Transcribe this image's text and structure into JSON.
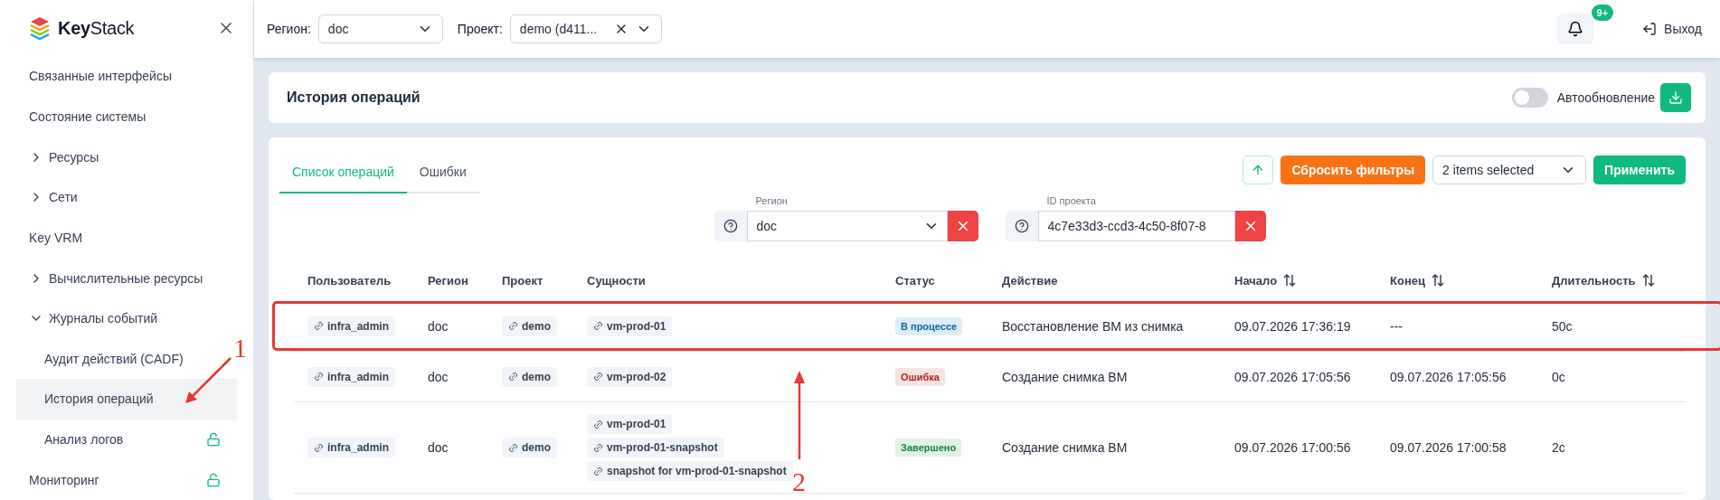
{
  "sidebar": {
    "logo": "**Key**Stack",
    "items": [
      {
        "label": "Связанные интерфейсы",
        "selected": false,
        "locked": false
      },
      {
        "label": "Состояние системы",
        "selected": false,
        "locked": false
      },
      {
        "label": "Ресурсы",
        "selected": false,
        "locked": false,
        "kind": "group",
        "expanded": false
      },
      {
        "label": "Сети",
        "selected": false,
        "locked": false,
        "kind": "group",
        "expanded": false
      },
      {
        "label": "Key VRM",
        "selected": false,
        "locked": false
      },
      {
        "label": "Вычислительные ресурсы",
        "selected": false,
        "locked": false,
        "kind": "group",
        "expanded": false
      },
      {
        "label": "Журналы событий",
        "selected": false,
        "locked": false,
        "kind": "group",
        "expanded": true,
        "children": [
          {
            "label": "Аудит действий (CADF)",
            "selected": false,
            "locked": false
          },
          {
            "label": "История операций",
            "selected": true,
            "locked": false
          },
          {
            "label": "Анализ логов",
            "selected": false,
            "locked": true
          }
        ]
      },
      {
        "label": "Мониторинг",
        "selected": false,
        "locked": true
      }
    ]
  },
  "topbar": {
    "region_label": "Регион:",
    "region_value": "doc",
    "project_label": "Проект:",
    "project_value": "demo (d411...",
    "notifications_badge": "9+",
    "logout": "Выход"
  },
  "header": {
    "title": "История операций",
    "autorefresh_label": "Автообновление",
    "autorefresh_on": false
  },
  "tabs": [
    {
      "label": "Список операций",
      "selected": true
    },
    {
      "label": "Ошибки",
      "selected": false
    }
  ],
  "toolbar": {
    "reset": "Сбросить фильтры",
    "columns_select": "2 items selected",
    "apply": "Применить"
  },
  "filters": [
    {
      "label": "Регион",
      "value": "doc",
      "kind": "select"
    },
    {
      "label": "ID проекта",
      "value": "4c7e33d3-ccd3-4c50-8f07-8",
      "kind": "input"
    }
  ],
  "table": {
    "columns": [
      {
        "label": "Пользователь",
        "sortable": false
      },
      {
        "label": "Регион",
        "sortable": false
      },
      {
        "label": "Проект",
        "sortable": false
      },
      {
        "label": "Сущности",
        "sortable": false
      },
      {
        "label": "Статус",
        "sortable": false
      },
      {
        "label": "Действие",
        "sortable": false
      },
      {
        "label": "Начало",
        "sortable": true
      },
      {
        "label": "Конец",
        "sortable": true
      },
      {
        "label": "Длительность",
        "sortable": true
      }
    ],
    "rows": [
      {
        "user": "infra_admin",
        "region": "doc",
        "project": "demo",
        "entities": [
          "vm-prod-01"
        ],
        "status": {
          "label": "В процессе",
          "kind": "in_progress"
        },
        "action": "Восстановление ВМ из снимка",
        "start": "09.07.2026 17:36:19",
        "end": "---",
        "duration": "50с",
        "highlighted": true
      },
      {
        "user": "infra_admin",
        "region": "doc",
        "project": "demo",
        "entities": [
          "vm-prod-02"
        ],
        "status": {
          "label": "Ошибка",
          "kind": "error"
        },
        "action": "Создание снимка ВМ",
        "start": "09.07.2026 17:05:56",
        "end": "09.07.2026 17:05:56",
        "duration": "0с",
        "highlighted": false
      },
      {
        "user": "infra_admin",
        "region": "doc",
        "project": "demo",
        "entities": [
          "vm-prod-01",
          "vm-prod-01-snapshot",
          "snapshot for vm-prod-01-snapshot"
        ],
        "status": {
          "label": "Завершено",
          "kind": "done"
        },
        "action": "Создание снимка ВМ",
        "start": "09.07.2026 17:00:56",
        "end": "09.07.2026 17:00:58",
        "duration": "2с",
        "highlighted": false
      }
    ]
  },
  "annotations": [
    {
      "label": "1"
    },
    {
      "label": "2"
    }
  ]
}
